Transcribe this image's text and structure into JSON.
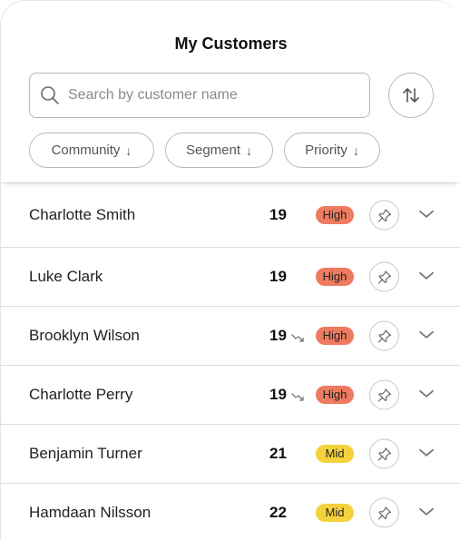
{
  "header": {
    "title": "My Customers",
    "search_placeholder": "Search by customer name",
    "filters": [
      {
        "label": "Community",
        "arrow": "↓"
      },
      {
        "label": "Segment",
        "arrow": "↓"
      },
      {
        "label": "Priority",
        "arrow": "↓"
      }
    ]
  },
  "customers": [
    {
      "name": "Charlotte Smith",
      "score": "19",
      "trend": false,
      "priority": "High"
    },
    {
      "name": "Luke Clark",
      "score": "19",
      "trend": false,
      "priority": "High"
    },
    {
      "name": "Brooklyn Wilson",
      "score": "19",
      "trend": true,
      "priority": "High"
    },
    {
      "name": "Charlotte Perry",
      "score": "19",
      "trend": true,
      "priority": "High"
    },
    {
      "name": "Benjamin Turner",
      "score": "21",
      "trend": false,
      "priority": "Mid"
    },
    {
      "name": "Hamdaan Nilsson",
      "score": "22",
      "trend": false,
      "priority": "Mid"
    }
  ],
  "colors": {
    "high": "#ee7b5f",
    "mid": "#f5d23c"
  },
  "icons": {
    "search": "search-icon",
    "sort": "sort-icon",
    "pin": "pin-icon",
    "expand": "chevron-down-icon",
    "trend": "trend-down-icon"
  }
}
